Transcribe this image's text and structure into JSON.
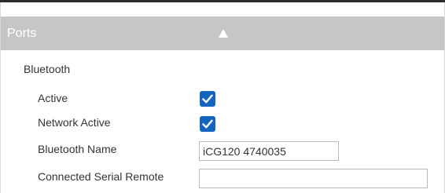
{
  "section": {
    "title": "Ports",
    "toggle_icon": "triangle-up-icon"
  },
  "bluetooth": {
    "group_title": "Bluetooth",
    "active": {
      "label": "Active",
      "checked": true
    },
    "network_active": {
      "label": "Network Active",
      "checked": true
    },
    "bluetooth_name": {
      "label": "Bluetooth Name",
      "value": "iCG120 4740035"
    },
    "connected_serial_remote": {
      "label": "Connected Serial Remote",
      "value": ""
    }
  },
  "colors": {
    "header_background": "#c6c6c6",
    "checkbox_accent": "#1565c0"
  }
}
